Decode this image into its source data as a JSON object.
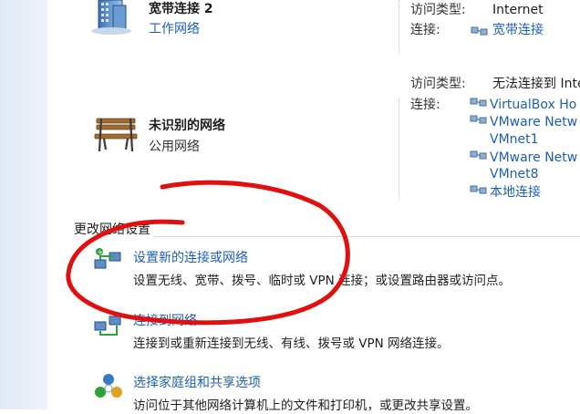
{
  "network1": {
    "name": "宽带连接 2",
    "type": "工作网络",
    "access_label": "访问类型:",
    "access_value": "Internet",
    "conn_label": "连接:",
    "conn_value": "宽带连接"
  },
  "network2": {
    "name": "未识别的网络",
    "type": "公用网络",
    "access_label": "访问类型:",
    "access_value": "无法连接到 Inte",
    "conn_label": "连接:",
    "connections": [
      "VirtualBox Ho",
      "VMware Netw",
      "VMnet1",
      "VMware Netw",
      "VMnet8",
      "本地连接"
    ]
  },
  "settings": {
    "heading": "更改网络设置",
    "items": [
      {
        "title": "设置新的连接或网络",
        "desc": "设置无线、宽带、拨号、临时或 VPN 连接；或设置路由器或访问点。"
      },
      {
        "title": "连接到网络",
        "desc": "连接到或重新连接到无线、有线、拨号或 VPN 网络连接。"
      },
      {
        "title": "选择家庭组和共享选项",
        "desc": "访问位于其他网络计算机上的文件和打印机，或更改共享设置。"
      }
    ]
  },
  "annotation_color": "#e01010",
  "link_color": "#1e5fb4"
}
